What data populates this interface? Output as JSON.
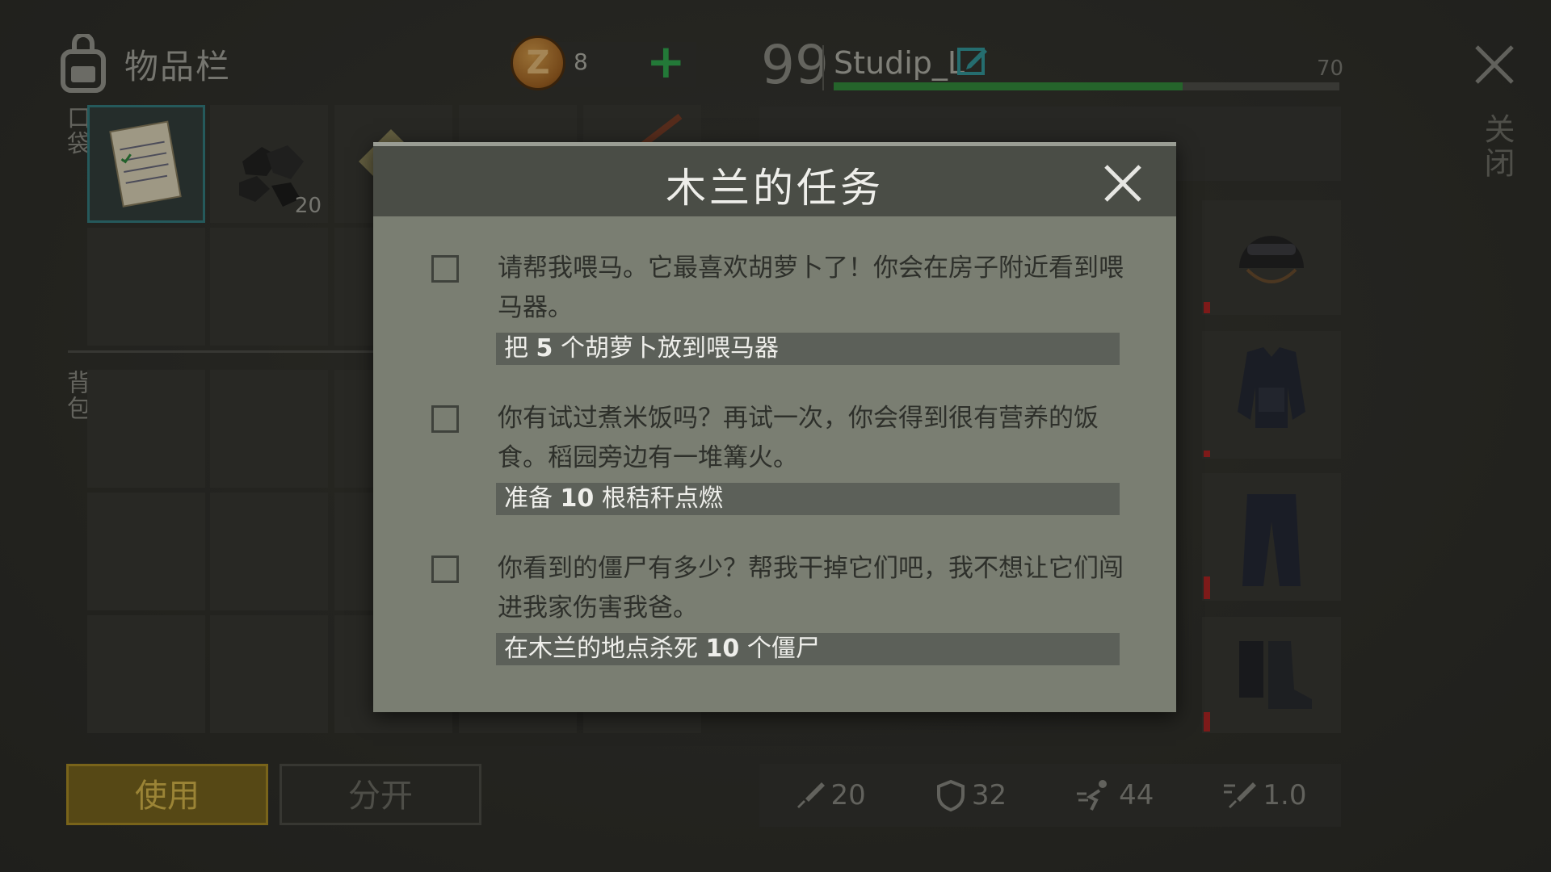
{
  "inventory": {
    "title": "物品栏",
    "pocket_label": "口袋",
    "backpack_label": "背包",
    "coins": "8",
    "add_label": "+",
    "slot_counts": [
      "",
      "20"
    ],
    "use_label": "使用",
    "split_label": "分开"
  },
  "player": {
    "level": "99",
    "name": "Studip_L",
    "xp_max": "70",
    "xp_fraction": 0.69
  },
  "close_label": "关闭",
  "stats": {
    "attack": "20",
    "defense": "32",
    "speed": "44",
    "attack_speed": "1.0"
  },
  "quest": {
    "title": "木兰的任务",
    "tasks": [
      {
        "desc": "请帮我喂马。它最喜欢胡萝卜了！你会在房子附近看到喂马器。",
        "goal_pre": "把",
        "goal_num": "5",
        "goal_post": "个胡萝卜放到喂马器"
      },
      {
        "desc": "你有试过煮米饭吗？再试一次，你会得到很有营养的饭食。稻园旁边有一堆篝火。",
        "goal_pre": "准备",
        "goal_num": "10",
        "goal_post": "根秸秆点燃"
      },
      {
        "desc": "你看到的僵尸有多少？帮我干掉它们吧，我不想让它们闯进我家伤害我爸。",
        "goal_pre": "在木兰的地点杀死",
        "goal_num": "10",
        "goal_post": "个僵尸"
      }
    ]
  },
  "colors": {
    "accent_green": "#2bb04e",
    "use_button": "#7a6518",
    "durability_red": "#b51e1e"
  }
}
